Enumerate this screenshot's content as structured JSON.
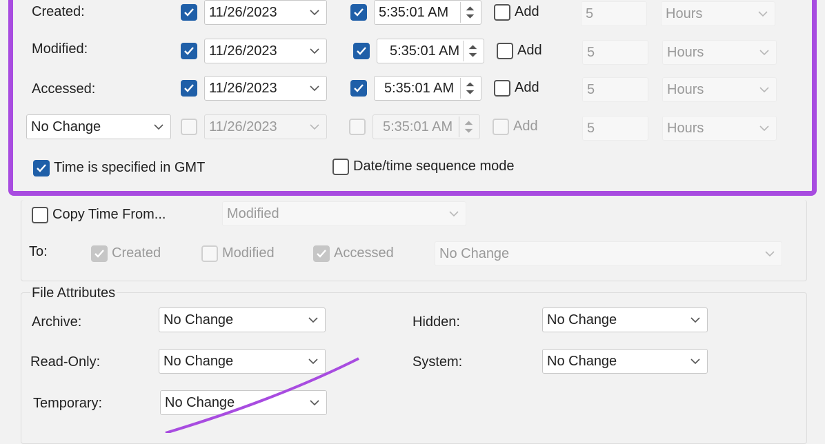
{
  "times": {
    "rows": [
      {
        "label": "Created:",
        "date": "11/26/2023",
        "time": "5:35:01 AM",
        "add_label": "Add",
        "amount": "5",
        "unit": "Hours"
      },
      {
        "label": "Modified:",
        "date": "11/26/2023",
        "time": "5:35:01 AM",
        "add_label": "Add",
        "amount": "5",
        "unit": "Hours"
      },
      {
        "label": "Accessed:",
        "date": "11/26/2023",
        "time": "5:35:01 AM",
        "add_label": "Add",
        "amount": "5",
        "unit": "Hours"
      },
      {
        "mode": "No Change",
        "date": "11/26/2023",
        "time": "5:35:01 AM",
        "add_label": "Add",
        "amount": "5",
        "unit": "Hours"
      }
    ],
    "gmt_label": "Time is specified in GMT",
    "sequence_label": "Date/time sequence mode"
  },
  "copy": {
    "label": "Copy Time From...",
    "source": "Modified",
    "to_label": "To:",
    "created_label": "Created",
    "modified_label": "Modified",
    "accessed_label": "Accessed",
    "target_mode": "No Change"
  },
  "attributes": {
    "title": "File Attributes",
    "archive_label": "Archive:",
    "archive_value": "No Change",
    "hidden_label": "Hidden:",
    "hidden_value": "No Change",
    "readonly_label": "Read-Only:",
    "readonly_value": "No Change",
    "system_label": "System:",
    "system_value": "No Change",
    "temporary_label": "Temporary:",
    "temporary_value": "No Change"
  },
  "colors": {
    "accent": "#a84ce0",
    "check": "#1f5fa8"
  }
}
